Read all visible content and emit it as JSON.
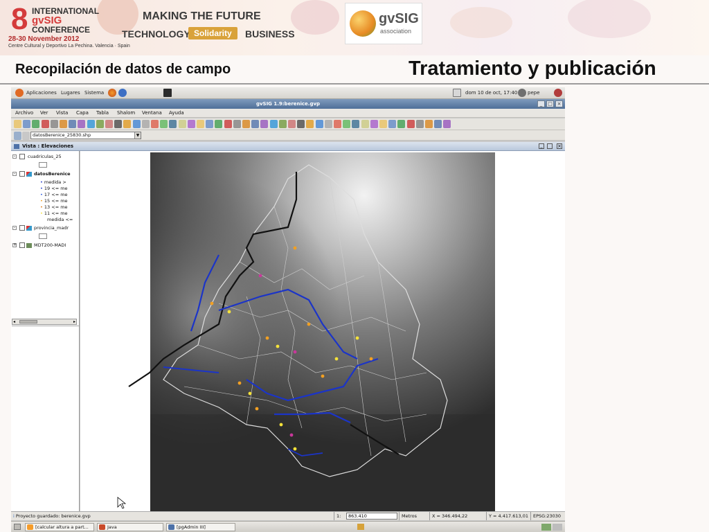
{
  "banner": {
    "conference_number": "8",
    "conference_name_lines": [
      "INTERNATIONAL",
      "gvSIG",
      "CONFERENCE"
    ],
    "dates": "28-30 November 2012",
    "venue": "Centre Cultural y Deportivo La Pechina. Valencia · Spain",
    "motto_line1": "MAKING THE FUTURE",
    "motto_technology": "TECHNOLOGY",
    "motto_solidarity": "Solidarity",
    "motto_business": "BUSINESS",
    "assoc_name": "gvSIG",
    "assoc_sub": "association"
  },
  "slide": {
    "title_left": "Recopilación de datos de campo",
    "title_right": "Tratamiento y publicación"
  },
  "gnome_panel": {
    "menus": [
      "Aplicaciones",
      "Lugares",
      "Sistema"
    ],
    "clock": "dom 10 de oct, 17:40",
    "user": "pepe"
  },
  "app": {
    "window_title": "gvSIG 1.9:berenice.gvp",
    "menus": [
      "Archivo",
      "Ver",
      "Vista",
      "Capa",
      "Tabla",
      "Shalom",
      "Ventana",
      "Ayuda"
    ],
    "active_layer": "datosBerenice_25830.shp",
    "view_title": "Vista : Elevaciones"
  },
  "toc": {
    "layers": [
      {
        "name": "cuadriculas_25",
        "checked": false
      },
      {
        "name": "datosBerenice",
        "checked": true
      },
      {
        "name": "provincia_madr",
        "checked": true
      },
      {
        "name": "MDT200-MADI",
        "checked": true
      }
    ],
    "legend": [
      "medida >",
      "19 <= me",
      "17 <= me",
      "15 <= me",
      "13 <= me",
      "11 <= me",
      "medida <="
    ]
  },
  "statusbar": {
    "message": "Proyecto guardado: berenice.gvp",
    "scale_prefix": "1:",
    "scale_value": "863.410",
    "units": "Metros",
    "x": "X = 346.494,22",
    "y": "Y = 4.417.613,01",
    "epsg": "EPSG:23030"
  },
  "taskbar": {
    "tasks": [
      "[calcular altura a part...",
      "Java",
      "[pgAdmin III]"
    ]
  },
  "colors": {
    "accent_red": "#d43b3b",
    "route_black": "#111111",
    "route_blue": "#1b34c8",
    "point_orange": "#f2a023",
    "point_yellow": "#f5e23a",
    "point_magenta": "#c8389a"
  }
}
